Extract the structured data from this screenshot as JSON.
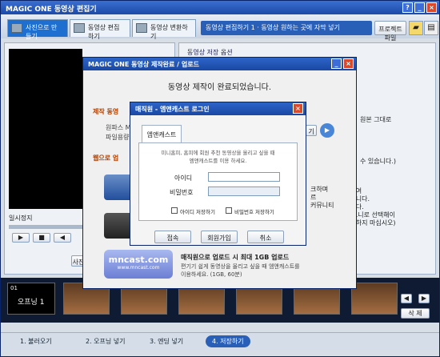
{
  "app": {
    "title": "MAGIC ONE 동영상 편집기"
  },
  "toolbar": {
    "tabs": [
      "사진으로 만들기",
      "동영상 편집하기",
      "동영상 변환하기"
    ],
    "breadcrumb": "동영상 편집하기 1 · 동영상 원하는 곳에 자막 넣기",
    "project_btn": "프로젝트 파일"
  },
  "left": {
    "status": "일시정지",
    "menu_btn": "사진"
  },
  "right_panel": {
    "title": "동영상 저장 옵션",
    "origin": "원본 그대로",
    "text1": "수 있습니다.)",
    "lines": [
      "크하여",
      "",
      "",
      "이집니다.",
      "됩니다.",
      "에 모니로 선택해이",
      "선택하지 마십시오)"
    ]
  },
  "thumbs": {
    "first_label": "오프닝 1",
    "first_index": "01",
    "delete_btn": "삭 제"
  },
  "steps": [
    "1. 불러오기",
    "2. 오프닝 넣기",
    "3. 엔딩 넣기",
    "4. 저장하기"
  ],
  "dialog": {
    "title": "MAGIC ONE 동영상 제작완료 / 업로드",
    "message": "동영상 제작이 완료되었습니다.",
    "section1": "제작 동영",
    "row1": "원파스 M",
    "row2": "파일용량",
    "section2": "웹으로 업",
    "open_btn": "기",
    "mnc_title": "매직원으로 업로드 시 최대 1GB 업로드",
    "mnc_desc1": "편기기 쉽게 동영상을 올리고 싶을 때 엠앤캐스트를",
    "mnc_desc2": "이용하세요. (1GB, 60분)",
    "mnc_logo": "mncast.com",
    "mnc_url": "www.mncast.com",
    "side_lines": [
      "크하며",
      "",
      "르",
      "커뮤니티"
    ]
  },
  "login": {
    "title": "매직원 - 엠앤캐스트 로그인",
    "tab": "엠앤캐스트",
    "desc1": "미니홈피, 홈피에 회원 추천 동영상을 올리고 싶을 때",
    "desc2": "엠앤캐스트를 이용 하세요.",
    "id_label": "아이디",
    "pw_label": "비밀번호",
    "save_id": "아이디 저장하기",
    "save_pw": "비밀번호 저장하기",
    "login_btn": "접속",
    "join_btn": "회원가입",
    "cancel_btn": "취소"
  }
}
